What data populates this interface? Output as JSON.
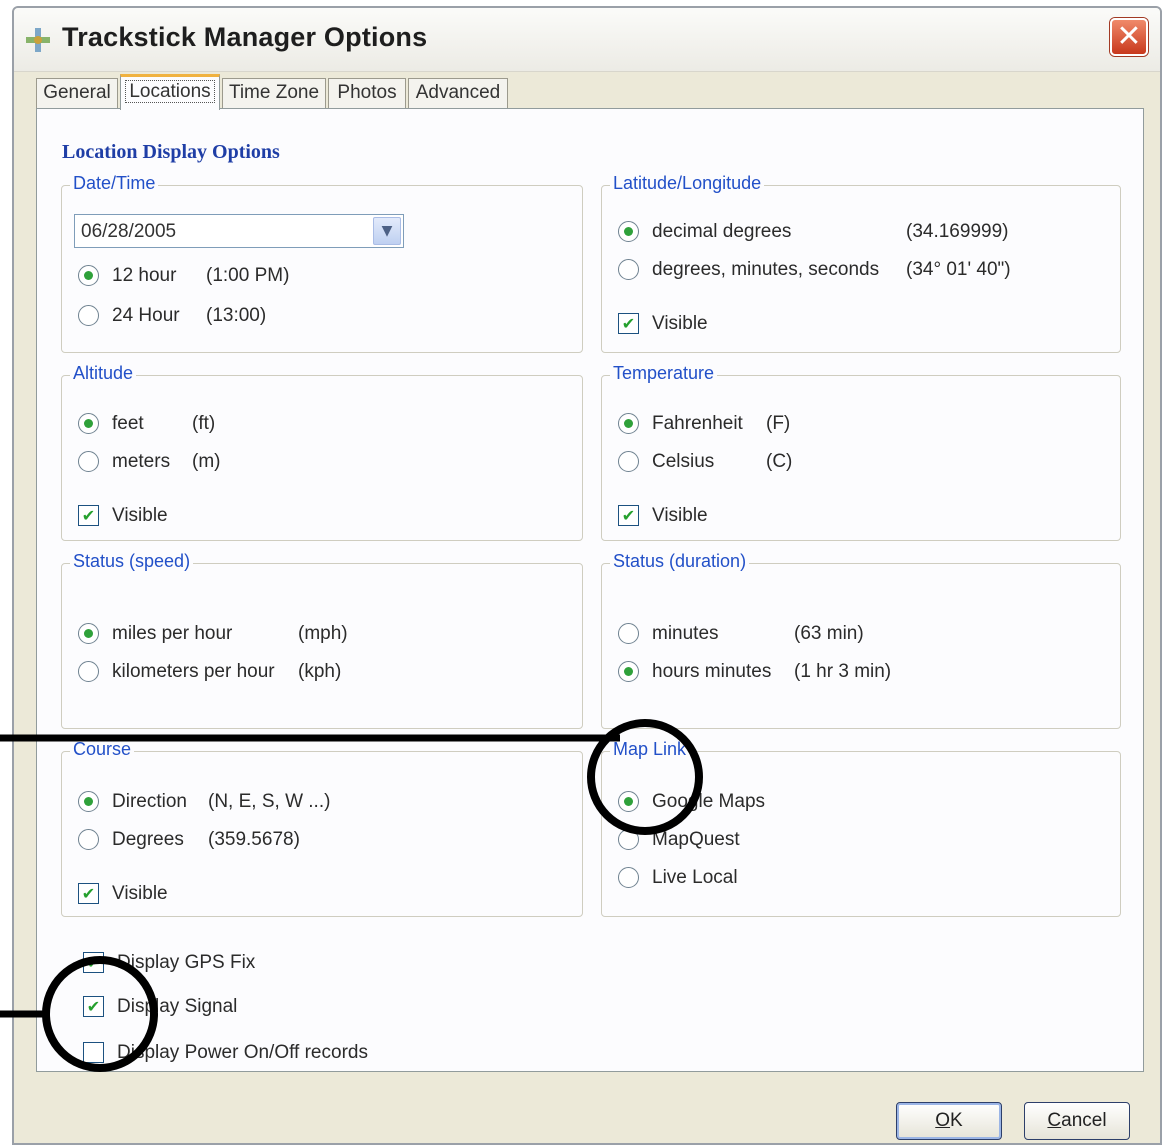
{
  "window": {
    "title": "Trackstick Manager Options",
    "close_glyph": "✕"
  },
  "tabs": [
    {
      "label": "General"
    },
    {
      "label": "Locations",
      "active": true
    },
    {
      "label": "Time Zone"
    },
    {
      "label": "Photos"
    },
    {
      "label": "Advanced"
    }
  ],
  "section_title": "Location Display Options",
  "date_time": {
    "title": "Date/Time",
    "date_value": "06/28/2005",
    "options": [
      {
        "label": "12 hour",
        "example": "(1:00 PM)",
        "selected": true
      },
      {
        "label": "24 Hour",
        "example": "(13:00)",
        "selected": false
      }
    ]
  },
  "latlong": {
    "title": "Latitude/Longitude",
    "options": [
      {
        "label": "decimal degrees",
        "example": "(34.169999)",
        "selected": true
      },
      {
        "label": "degrees, minutes, seconds",
        "example": "(34° 01' 40\")",
        "selected": false
      }
    ],
    "visible_label": "Visible",
    "visible_checked": true
  },
  "altitude": {
    "title": "Altitude",
    "options": [
      {
        "label": "feet",
        "example": "(ft)",
        "selected": true
      },
      {
        "label": "meters",
        "example": "(m)",
        "selected": false
      }
    ],
    "visible_label": "Visible",
    "visible_checked": true
  },
  "temperature": {
    "title": "Temperature",
    "options": [
      {
        "label": "Fahrenheit",
        "example": "(F)",
        "selected": true
      },
      {
        "label": "Celsius",
        "example": "(C)",
        "selected": false
      }
    ],
    "visible_label": "Visible",
    "visible_checked": true
  },
  "speed": {
    "title": "Status (speed)",
    "options": [
      {
        "label": "miles per hour",
        "example": "(mph)",
        "selected": true
      },
      {
        "label": "kilometers per hour",
        "example": "(kph)",
        "selected": false
      }
    ]
  },
  "duration": {
    "title": "Status (duration)",
    "options": [
      {
        "label": "minutes",
        "example": "(63 min)",
        "selected": false
      },
      {
        "label": "hours minutes",
        "example": "(1 hr 3 min)",
        "selected": true
      }
    ]
  },
  "course": {
    "title": "Course",
    "options": [
      {
        "label": "Direction",
        "example": "(N, E, S, W ...)",
        "selected": true
      },
      {
        "label": "Degrees",
        "example": "(359.5678)",
        "selected": false
      }
    ],
    "visible_label": "Visible",
    "visible_checked": true
  },
  "maplink": {
    "title": "Map Link",
    "options": [
      {
        "label": "Google Maps",
        "selected": true
      },
      {
        "label": "MapQuest",
        "selected": false
      },
      {
        "label": "Live Local",
        "selected": false
      }
    ]
  },
  "bottom_checks": [
    {
      "label": "Display GPS Fix",
      "checked": true
    },
    {
      "label": "Display Signal",
      "checked": true
    },
    {
      "label": "Display Power On/Off records",
      "checked": false
    }
  ],
  "buttons": {
    "ok": {
      "mnemonic": "O",
      "rest": "K"
    },
    "cancel": {
      "mnemonic": "C",
      "rest": "ancel"
    }
  },
  "check_glyph": "✔"
}
